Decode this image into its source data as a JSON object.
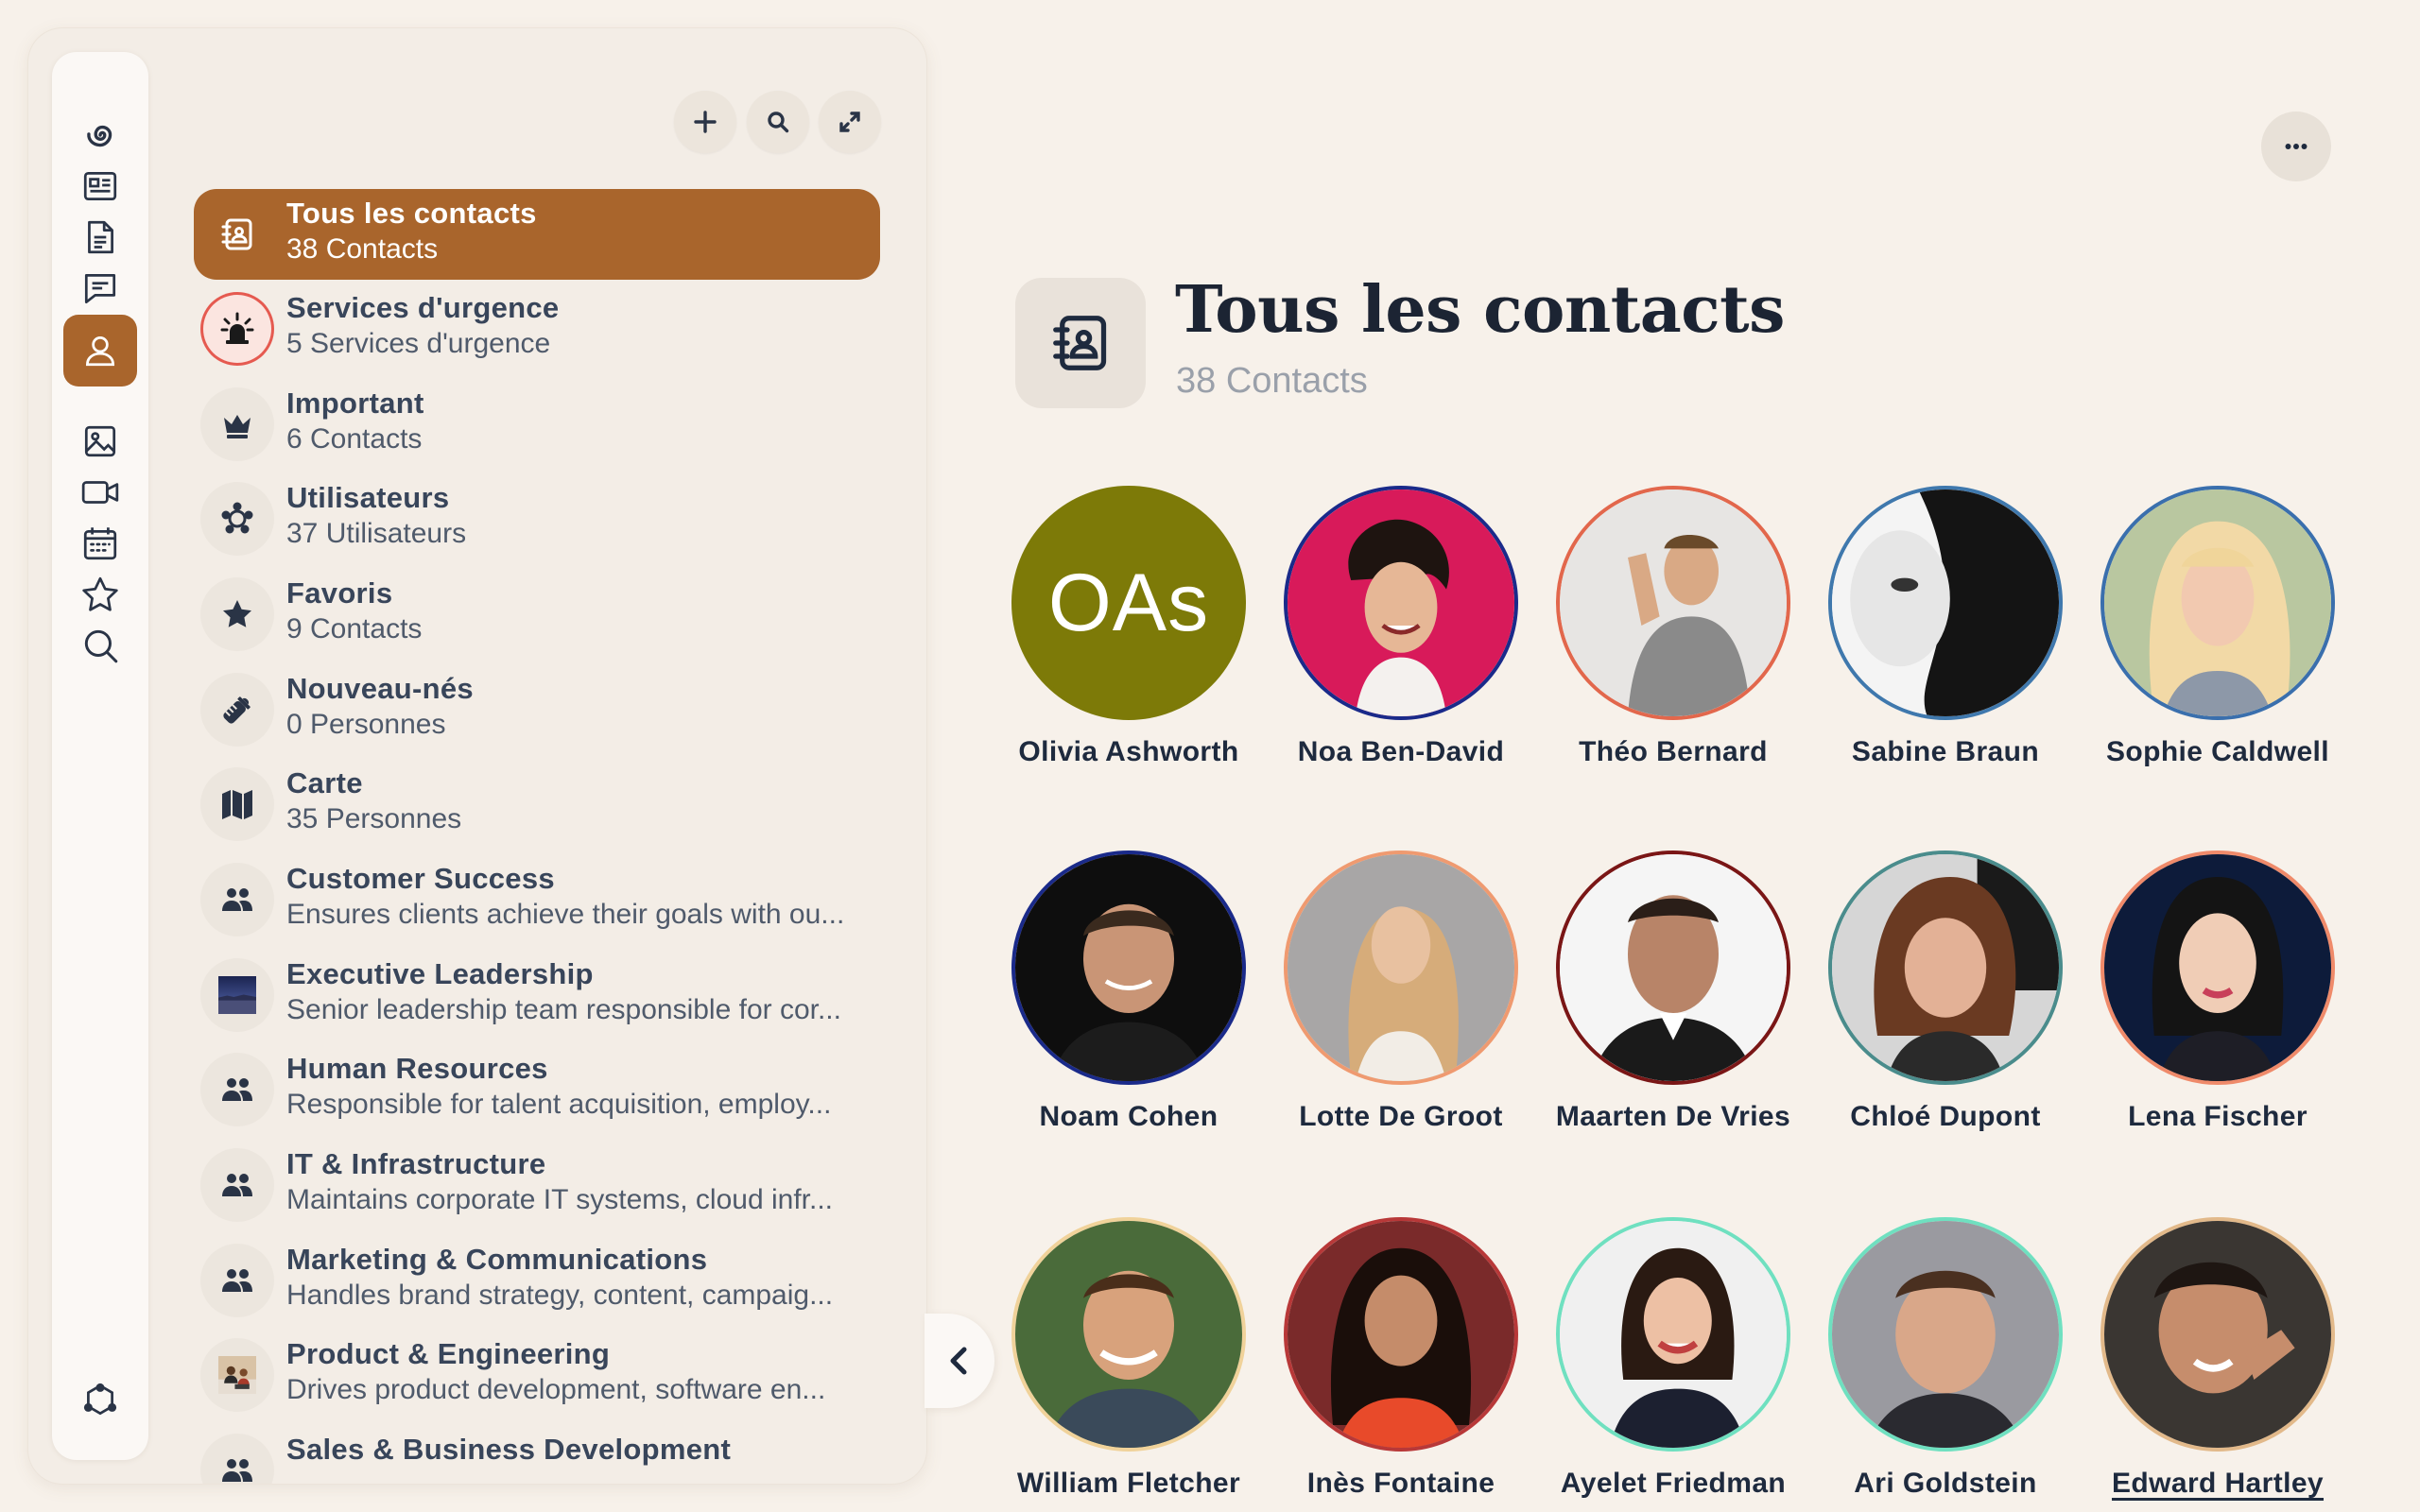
{
  "header": {
    "actions": [
      {
        "icon": "plus-icon",
        "label": "add"
      },
      {
        "icon": "search-icon",
        "label": "search"
      },
      {
        "icon": "expand-icon",
        "label": "expand"
      }
    ]
  },
  "rail": {
    "items": [
      {
        "icon": "spiral-logo-icon",
        "active": false
      },
      {
        "icon": "news-icon",
        "active": false
      },
      {
        "icon": "document-icon",
        "active": false
      },
      {
        "icon": "chat-icon",
        "active": false
      },
      {
        "icon": "checkbox-icon",
        "active": false
      },
      {
        "icon": "person-icon",
        "active": true
      },
      {
        "icon": "image-icon",
        "active": false
      },
      {
        "icon": "video-icon",
        "active": false
      },
      {
        "icon": "calendar-icon",
        "active": false
      },
      {
        "icon": "star-icon",
        "active": false
      },
      {
        "icon": "search-icon",
        "active": false
      },
      {
        "icon": "settings-icon",
        "active": false
      }
    ]
  },
  "groups": [
    {
      "title": "Tous les contacts",
      "subtitle": "38 Contacts",
      "icon": "address-book-icon",
      "selected": true
    },
    {
      "title": "Services d'urgence",
      "subtitle": "5 Services d'urgence",
      "icon": "siren-icon"
    },
    {
      "title": "Important",
      "subtitle": "6 Contacts",
      "icon": "crown-icon"
    },
    {
      "title": "Utilisateurs",
      "subtitle": "37 Utilisateurs",
      "icon": "users-circle-icon"
    },
    {
      "title": "Favoris",
      "subtitle": "9 Contacts",
      "icon": "star-icon"
    },
    {
      "title": "Nouveau-nés",
      "subtitle": "0 Personnes",
      "icon": "baby-bottle-icon"
    },
    {
      "title": "Carte",
      "subtitle": "35 Personnes",
      "icon": "map-icon"
    },
    {
      "title": "Customer Success",
      "subtitle": "Ensures clients achieve their goals with ou...",
      "icon": "team-icon"
    },
    {
      "title": "Executive Leadership",
      "subtitle": "Senior leadership team responsible for cor...",
      "icon": "landscape-photo"
    },
    {
      "title": "Human Resources",
      "subtitle": "Responsible for talent acquisition, employ...",
      "icon": "team-icon"
    },
    {
      "title": "IT & Infrastructure",
      "subtitle": "Maintains corporate IT systems, cloud infr...",
      "icon": "team-icon"
    },
    {
      "title": "Marketing & Communications",
      "subtitle": "Handles brand strategy, content, campaig...",
      "icon": "team-icon"
    },
    {
      "title": "Product & Engineering",
      "subtitle": "Drives product development, software en...",
      "icon": "team-photo"
    },
    {
      "title": "Sales & Business Development",
      "subtitle": "",
      "icon": "team-icon"
    }
  ],
  "main": {
    "title": "Tous les contacts",
    "subtitle": "38 Contacts",
    "more_icon": "more-icon"
  },
  "contacts": [
    {
      "name": "Olivia Ashworth",
      "initials": "OAs",
      "ring": "#7d7a08"
    },
    {
      "name": "Noa Ben-David",
      "ring": "#1a2a8a"
    },
    {
      "name": "Théo Bernard",
      "ring": "#e2674c"
    },
    {
      "name": "Sabine Braun",
      "ring": "#3f78ad"
    },
    {
      "name": "Sophie Caldwell",
      "ring": "#3a6fad"
    },
    {
      "name": "Noam Cohen",
      "ring": "#1a2a8a"
    },
    {
      "name": "Lotte De Groot",
      "ring": "#ef9a70"
    },
    {
      "name": "Maarten De Vries",
      "ring": "#7a1616"
    },
    {
      "name": "Chloé Dupont",
      "ring": "#4a8c8c"
    },
    {
      "name": "Lena Fischer",
      "ring": "#ef8a6a"
    },
    {
      "name": "William Fletcher",
      "ring": "#f0d29a"
    },
    {
      "name": "Inès Fontaine",
      "ring": "#b83838"
    },
    {
      "name": "Ayelet Friedman",
      "ring": "#6fe0c0"
    },
    {
      "name": "Ari Goldstein",
      "ring": "#6fe0c0"
    },
    {
      "name": "Edward Hartley",
      "ring": "#e2b98a"
    }
  ]
}
